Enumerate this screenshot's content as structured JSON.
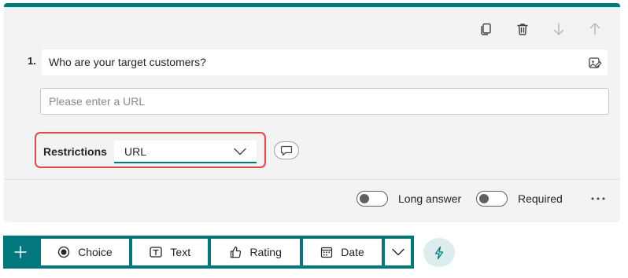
{
  "question": {
    "number": "1.",
    "title": "Who are your target customers?",
    "answer_placeholder": "Please enter a URL"
  },
  "restrictions": {
    "label": "Restrictions",
    "selected": "URL"
  },
  "options": {
    "long_answer_label": "Long answer",
    "long_answer_on": false,
    "required_label": "Required",
    "required_on": false
  },
  "add_bar": {
    "buttons": [
      {
        "label": "Choice",
        "icon": "radio-icon"
      },
      {
        "label": "Text",
        "icon": "text-icon"
      },
      {
        "label": "Rating",
        "icon": "thumb-up-icon"
      },
      {
        "label": "Date",
        "icon": "calendar-icon"
      }
    ]
  },
  "colors": {
    "accent": "#03787c",
    "highlight": "#e8474d",
    "card_bg": "#f3f3f3"
  }
}
